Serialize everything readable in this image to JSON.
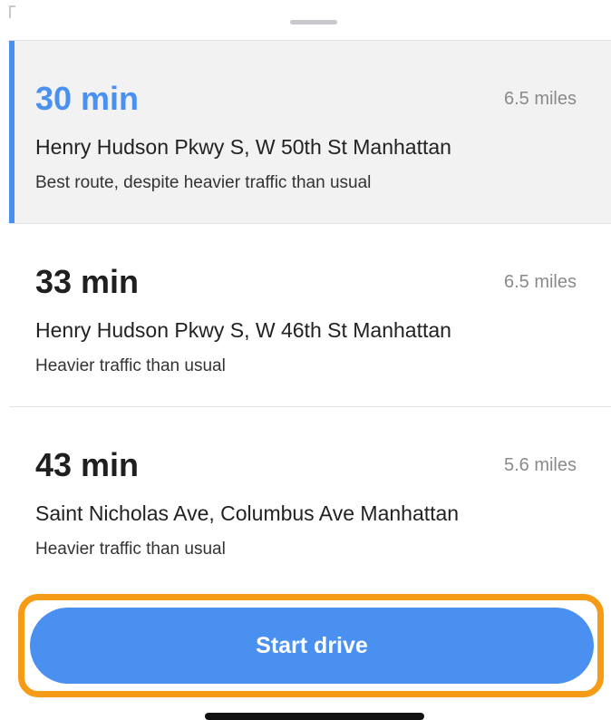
{
  "routes": [
    {
      "time": "30 min",
      "distance": "6.5 miles",
      "road": "Henry Hudson Pkwy S, W 50th St Manhattan",
      "note": "Best route, despite heavier traffic than usual",
      "selected": true
    },
    {
      "time": "33 min",
      "distance": "6.5 miles",
      "road": "Henry Hudson Pkwy S, W 46th St Manhattan",
      "note": "Heavier traffic than usual",
      "selected": false
    },
    {
      "time": "43 min",
      "distance": "5.6 miles",
      "road": "Saint Nicholas Ave, Columbus Ave Manhattan",
      "note": "Heavier traffic than usual",
      "selected": false
    }
  ],
  "start_button": {
    "label": "Start drive"
  },
  "colors": {
    "accent": "#4a90f0",
    "highlight_border": "#f59b16",
    "selected_background": "#f2f2f2"
  }
}
